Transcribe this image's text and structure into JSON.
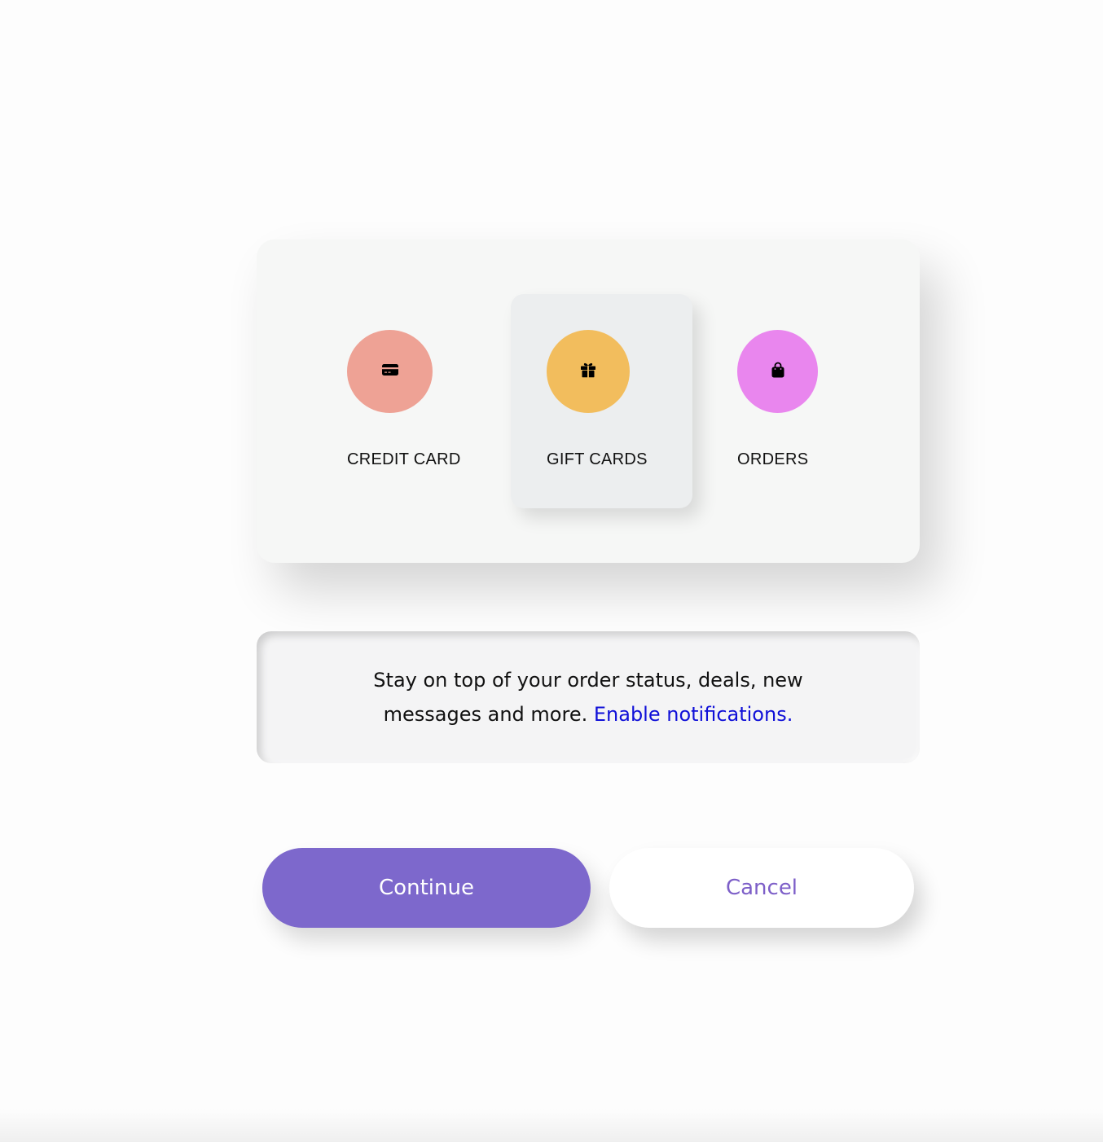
{
  "categories": [
    {
      "label": "CREDIT CARD",
      "icon": "credit-card-icon",
      "color": "#eea295"
    },
    {
      "label": "GIFT CARDS",
      "icon": "gift-icon",
      "color": "#f2bd5d",
      "selected": true
    },
    {
      "label": "ORDERS",
      "icon": "shopping-bag-icon",
      "color": "#e986ee"
    }
  ],
  "notification": {
    "text": "Stay on top of your order status, deals, new messages and more.",
    "link_text": "Enable notifications.",
    "link_color": "#1010d8"
  },
  "buttons": {
    "continue_label": "Continue",
    "cancel_label": "Cancel",
    "accent_color": "#7d68cc"
  }
}
